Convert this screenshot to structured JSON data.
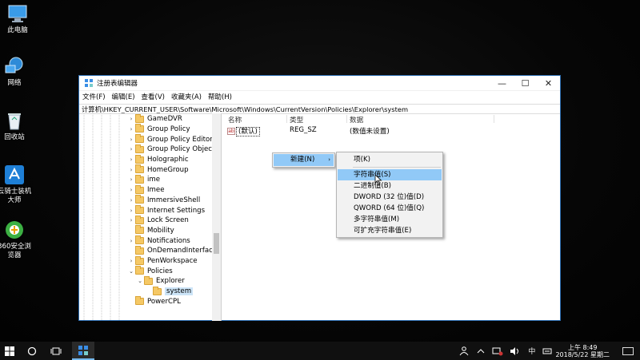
{
  "desktop": {
    "icons": [
      {
        "label": "此电脑",
        "icon": "computer-icon"
      },
      {
        "label": "网络",
        "icon": "network-icon"
      },
      {
        "label": "回收站",
        "icon": "recycle-bin-icon"
      },
      {
        "label": "云骑士装机大师",
        "icon": "installer-app-icon"
      },
      {
        "label": "360安全浏览器",
        "icon": "browser-icon"
      }
    ]
  },
  "window": {
    "title": "注册表编辑器",
    "controls": {
      "minimize": "—",
      "maximize": "☐",
      "close": "✕"
    },
    "menu": [
      "文件(F)",
      "编辑(E)",
      "查看(V)",
      "收藏夹(A)",
      "帮助(H)"
    ],
    "address": "计算机\\HKEY_CURRENT_USER\\Software\\Microsoft\\Windows\\CurrentVersion\\Policies\\Explorer\\system",
    "tree": [
      {
        "label": "GameDVR",
        "expander": "›"
      },
      {
        "label": "Group Policy",
        "expander": "›"
      },
      {
        "label": "Group Policy Editor",
        "expander": "›"
      },
      {
        "label": "Group Policy Objects",
        "expander": "›"
      },
      {
        "label": "Holographic",
        "expander": "›"
      },
      {
        "label": "HomeGroup",
        "expander": "›"
      },
      {
        "label": "ime",
        "expander": "›"
      },
      {
        "label": "Imee",
        "expander": "›"
      },
      {
        "label": "ImmersiveShell",
        "expander": "›"
      },
      {
        "label": "Internet Settings",
        "expander": "›"
      },
      {
        "label": "Lock Screen",
        "expander": "›"
      },
      {
        "label": "Mobility",
        "expander": ""
      },
      {
        "label": "Notifications",
        "expander": "›"
      },
      {
        "label": "OnDemandInterfaceC",
        "expander": ""
      },
      {
        "label": "PenWorkspace",
        "expander": "›"
      },
      {
        "label": "Policies",
        "expander": "⌄"
      },
      {
        "label": "Explorer",
        "expander": "⌄"
      },
      {
        "label": "system",
        "expander": "",
        "selected": true
      },
      {
        "label": "PowerCPL",
        "expander": ""
      }
    ],
    "columns": {
      "name": "名称",
      "type": "类型",
      "data": "数据"
    },
    "values": [
      {
        "name": "(默认)",
        "type": "REG_SZ",
        "data": "(数值未设置)",
        "icon": "ab"
      }
    ]
  },
  "context_menu": {
    "item": "新建(N)",
    "arrow": "›",
    "submenu": [
      "项(K)",
      "字符串值(S)",
      "二进制值(B)",
      "DWORD (32 位)值(D)",
      "QWORD (64 位)值(Q)",
      "多字符串值(M)",
      "可扩充字符串值(E)"
    ],
    "highlighted": "字符串值(S)"
  },
  "taskbar": {
    "tray": {
      "ime": "中",
      "time": "上午 8:49",
      "date": "2018/5/22 星期二"
    }
  }
}
